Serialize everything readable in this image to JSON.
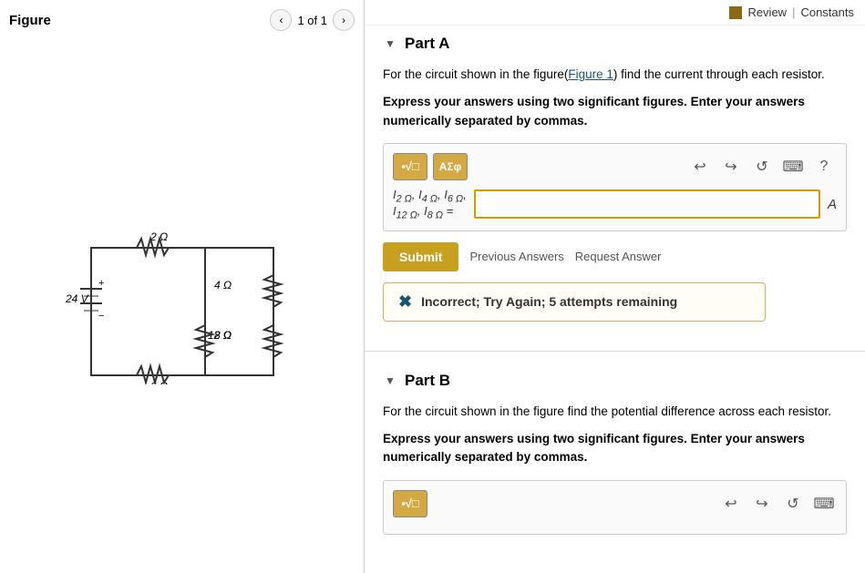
{
  "topbar": {
    "review_label": "Review",
    "constants_label": "Constants",
    "separator": "|"
  },
  "figure": {
    "title": "Figure",
    "page": "1 of 1"
  },
  "partA": {
    "label": "Part A",
    "question": "For the circuit shown in the figure(",
    "figure_link": "Figure 1",
    "question_end": ") find the current through each resistor.",
    "instructions": "Express your answers using two significant figures. Enter your answers numerically separated by commas.",
    "input_label": "I₂ Ω, I₄ Ω, I₆ Ω, I₁₂ Ω, I₈ Ω =",
    "submit_label": "Submit",
    "previous_answers_label": "Previous Answers",
    "request_answer_label": "Request Answer",
    "feedback": "Incorrect; Try Again; 5 attempts remaining"
  },
  "partB": {
    "label": "Part B",
    "question": "For the circuit shown in the figure find the potential difference across each resistor.",
    "instructions": "Express your answers using two significant figures. Enter your answers numerically separated by commas."
  },
  "toolbar": {
    "math_btn": "▪√□",
    "symbol_btn": "ΑΣφ",
    "undo_icon": "↩",
    "redo_icon": "↪",
    "reset_icon": "↺",
    "keyboard_icon": "⌨",
    "help_icon": "?"
  }
}
